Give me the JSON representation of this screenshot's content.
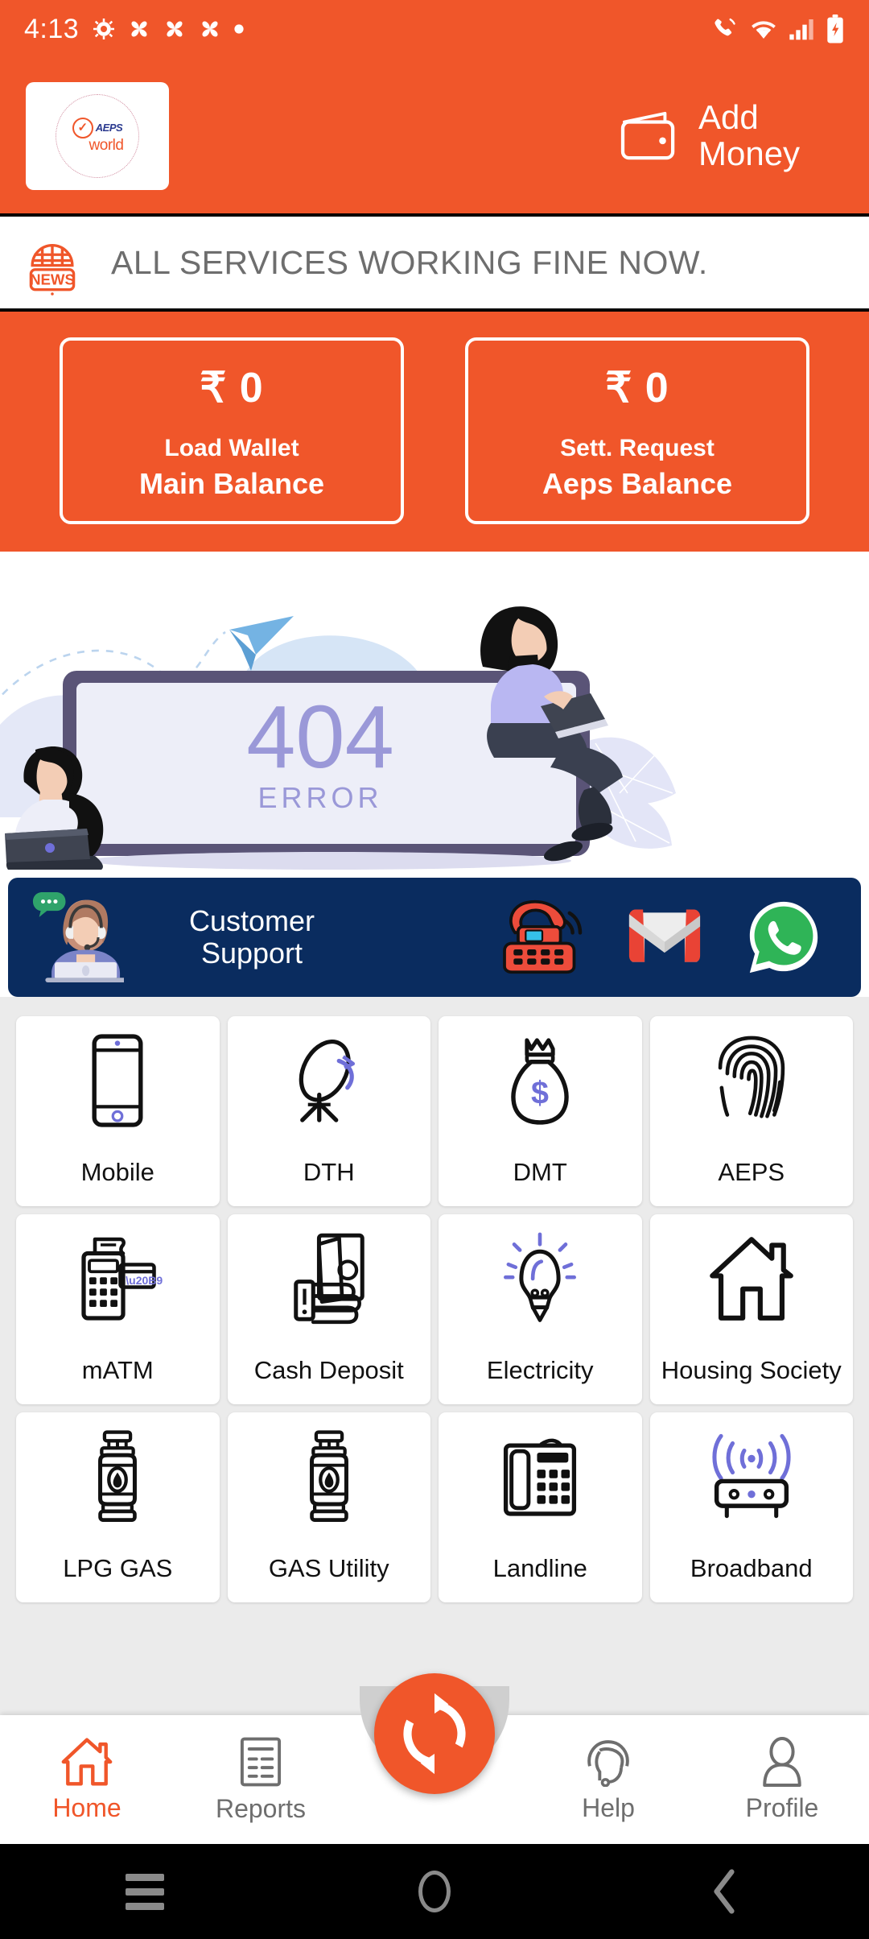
{
  "status_bar": {
    "time": "4:13",
    "left_icons": [
      "gear-icon",
      "app-icon-1",
      "app-icon-2",
      "app-icon-3",
      "dot-icon"
    ],
    "right_icons": [
      "call-icon",
      "wifi-icon",
      "signal-icon",
      "battery-charging-icon"
    ]
  },
  "header": {
    "logo": {
      "brand_top": "AEPS",
      "brand_bottom": "world",
      "check": "✓"
    },
    "add_money_label": "Add Money",
    "wallet_icon": "wallet-icon"
  },
  "news_ticker": {
    "icon": "news-globe-icon",
    "icon_label": "NEWS",
    "message": "ALL SERVICES WORKING FINE NOW."
  },
  "balances": [
    {
      "amount": "₹ 0",
      "action": "Load Wallet",
      "label": "Main Balance"
    },
    {
      "amount": "₹ 0",
      "action": "Sett. Request",
      "label": "Aeps Balance"
    }
  ],
  "banner": {
    "code": "404",
    "caption": "ERROR"
  },
  "support": {
    "title_line1": "Customer",
    "title_line2": "Support",
    "agent_icon": "support-agent-icon",
    "channels": [
      {
        "name": "phone-icon",
        "label": "Call"
      },
      {
        "name": "gmail-icon",
        "label": "Email"
      },
      {
        "name": "whatsapp-icon",
        "label": "WhatsApp"
      }
    ]
  },
  "services": [
    {
      "label": "Mobile",
      "icon": "mobile-icon"
    },
    {
      "label": "DTH",
      "icon": "satellite-dish-icon"
    },
    {
      "label": "DMT",
      "icon": "money-bag-icon"
    },
    {
      "label": "AEPS",
      "icon": "fingerprint-icon"
    },
    {
      "label": "mATM",
      "icon": "pos-terminal-icon"
    },
    {
      "label": "Cash Deposit",
      "icon": "cash-hand-icon"
    },
    {
      "label": "Electricity",
      "icon": "light-bulb-icon"
    },
    {
      "label": "Housing Society",
      "icon": "house-icon"
    },
    {
      "label": "LPG GAS",
      "icon": "gas-cylinder-icon"
    },
    {
      "label": "GAS Utility",
      "icon": "gas-cylinder-icon"
    },
    {
      "label": "Landline",
      "icon": "desk-phone-icon"
    },
    {
      "label": "Broadband",
      "icon": "router-icon"
    }
  ],
  "bottom_nav": {
    "items": [
      {
        "label": "Home",
        "icon": "home-icon",
        "active": true
      },
      {
        "label": "Reports",
        "icon": "report-icon",
        "active": false
      },
      {
        "label": "Help",
        "icon": "headset-icon",
        "active": false
      },
      {
        "label": "Profile",
        "icon": "person-icon",
        "active": false
      }
    ],
    "fab_icon": "refresh-icon"
  },
  "android_nav": {
    "recents": "recents-icon",
    "home": "home-circle-icon",
    "back": "back-icon"
  },
  "colors": {
    "brand_orange": "#F0562A",
    "support_navy": "#0A2C5F",
    "grid_bg": "#EBEBEB",
    "news_text": "#6E6E6E",
    "nav_inactive": "#6E6E6E"
  }
}
